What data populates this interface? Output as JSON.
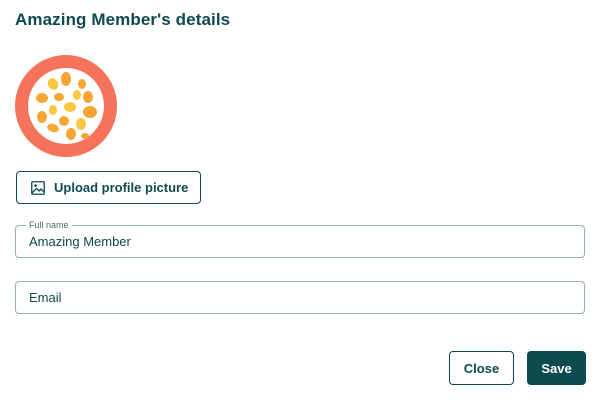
{
  "dialog": {
    "title": "Amazing Member's details"
  },
  "avatar": {
    "description_icon": "passion-fruit-avatar",
    "colors": {
      "rim": "#f4735a",
      "pulp": "#ffffff",
      "seed_dark": "#f6a635",
      "seed_light": "#fbc640"
    }
  },
  "upload": {
    "label": "Upload profile picture",
    "icon": "image-icon"
  },
  "form": {
    "full_name": {
      "label": "Full name",
      "value": "Amazing Member"
    },
    "email": {
      "placeholder": "Email",
      "value": ""
    }
  },
  "actions": {
    "close_label": "Close",
    "save_label": "Save"
  },
  "theme": {
    "primary": "#0e4a4f",
    "border": "#9aaeb0"
  }
}
